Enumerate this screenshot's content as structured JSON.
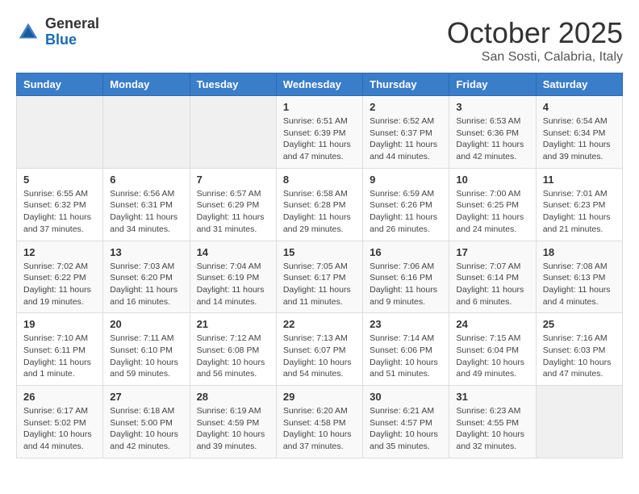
{
  "header": {
    "logo_general": "General",
    "logo_blue": "Blue",
    "month_title": "October 2025",
    "location": "San Sosti, Calabria, Italy"
  },
  "days_of_week": [
    "Sunday",
    "Monday",
    "Tuesday",
    "Wednesday",
    "Thursday",
    "Friday",
    "Saturday"
  ],
  "weeks": [
    [
      {
        "day": "",
        "info": ""
      },
      {
        "day": "",
        "info": ""
      },
      {
        "day": "",
        "info": ""
      },
      {
        "day": "1",
        "info": "Sunrise: 6:51 AM\nSunset: 6:39 PM\nDaylight: 11 hours\nand 47 minutes."
      },
      {
        "day": "2",
        "info": "Sunrise: 6:52 AM\nSunset: 6:37 PM\nDaylight: 11 hours\nand 44 minutes."
      },
      {
        "day": "3",
        "info": "Sunrise: 6:53 AM\nSunset: 6:36 PM\nDaylight: 11 hours\nand 42 minutes."
      },
      {
        "day": "4",
        "info": "Sunrise: 6:54 AM\nSunset: 6:34 PM\nDaylight: 11 hours\nand 39 minutes."
      }
    ],
    [
      {
        "day": "5",
        "info": "Sunrise: 6:55 AM\nSunset: 6:32 PM\nDaylight: 11 hours\nand 37 minutes."
      },
      {
        "day": "6",
        "info": "Sunrise: 6:56 AM\nSunset: 6:31 PM\nDaylight: 11 hours\nand 34 minutes."
      },
      {
        "day": "7",
        "info": "Sunrise: 6:57 AM\nSunset: 6:29 PM\nDaylight: 11 hours\nand 31 minutes."
      },
      {
        "day": "8",
        "info": "Sunrise: 6:58 AM\nSunset: 6:28 PM\nDaylight: 11 hours\nand 29 minutes."
      },
      {
        "day": "9",
        "info": "Sunrise: 6:59 AM\nSunset: 6:26 PM\nDaylight: 11 hours\nand 26 minutes."
      },
      {
        "day": "10",
        "info": "Sunrise: 7:00 AM\nSunset: 6:25 PM\nDaylight: 11 hours\nand 24 minutes."
      },
      {
        "day": "11",
        "info": "Sunrise: 7:01 AM\nSunset: 6:23 PM\nDaylight: 11 hours\nand 21 minutes."
      }
    ],
    [
      {
        "day": "12",
        "info": "Sunrise: 7:02 AM\nSunset: 6:22 PM\nDaylight: 11 hours\nand 19 minutes."
      },
      {
        "day": "13",
        "info": "Sunrise: 7:03 AM\nSunset: 6:20 PM\nDaylight: 11 hours\nand 16 minutes."
      },
      {
        "day": "14",
        "info": "Sunrise: 7:04 AM\nSunset: 6:19 PM\nDaylight: 11 hours\nand 14 minutes."
      },
      {
        "day": "15",
        "info": "Sunrise: 7:05 AM\nSunset: 6:17 PM\nDaylight: 11 hours\nand 11 minutes."
      },
      {
        "day": "16",
        "info": "Sunrise: 7:06 AM\nSunset: 6:16 PM\nDaylight: 11 hours\nand 9 minutes."
      },
      {
        "day": "17",
        "info": "Sunrise: 7:07 AM\nSunset: 6:14 PM\nDaylight: 11 hours\nand 6 minutes."
      },
      {
        "day": "18",
        "info": "Sunrise: 7:08 AM\nSunset: 6:13 PM\nDaylight: 11 hours\nand 4 minutes."
      }
    ],
    [
      {
        "day": "19",
        "info": "Sunrise: 7:10 AM\nSunset: 6:11 PM\nDaylight: 11 hours\nand 1 minute."
      },
      {
        "day": "20",
        "info": "Sunrise: 7:11 AM\nSunset: 6:10 PM\nDaylight: 10 hours\nand 59 minutes."
      },
      {
        "day": "21",
        "info": "Sunrise: 7:12 AM\nSunset: 6:08 PM\nDaylight: 10 hours\nand 56 minutes."
      },
      {
        "day": "22",
        "info": "Sunrise: 7:13 AM\nSunset: 6:07 PM\nDaylight: 10 hours\nand 54 minutes."
      },
      {
        "day": "23",
        "info": "Sunrise: 7:14 AM\nSunset: 6:06 PM\nDaylight: 10 hours\nand 51 minutes."
      },
      {
        "day": "24",
        "info": "Sunrise: 7:15 AM\nSunset: 6:04 PM\nDaylight: 10 hours\nand 49 minutes."
      },
      {
        "day": "25",
        "info": "Sunrise: 7:16 AM\nSunset: 6:03 PM\nDaylight: 10 hours\nand 47 minutes."
      }
    ],
    [
      {
        "day": "26",
        "info": "Sunrise: 6:17 AM\nSunset: 5:02 PM\nDaylight: 10 hours\nand 44 minutes."
      },
      {
        "day": "27",
        "info": "Sunrise: 6:18 AM\nSunset: 5:00 PM\nDaylight: 10 hours\nand 42 minutes."
      },
      {
        "day": "28",
        "info": "Sunrise: 6:19 AM\nSunset: 4:59 PM\nDaylight: 10 hours\nand 39 minutes."
      },
      {
        "day": "29",
        "info": "Sunrise: 6:20 AM\nSunset: 4:58 PM\nDaylight: 10 hours\nand 37 minutes."
      },
      {
        "day": "30",
        "info": "Sunrise: 6:21 AM\nSunset: 4:57 PM\nDaylight: 10 hours\nand 35 minutes."
      },
      {
        "day": "31",
        "info": "Sunrise: 6:23 AM\nSunset: 4:55 PM\nDaylight: 10 hours\nand 32 minutes."
      },
      {
        "day": "",
        "info": ""
      }
    ]
  ]
}
